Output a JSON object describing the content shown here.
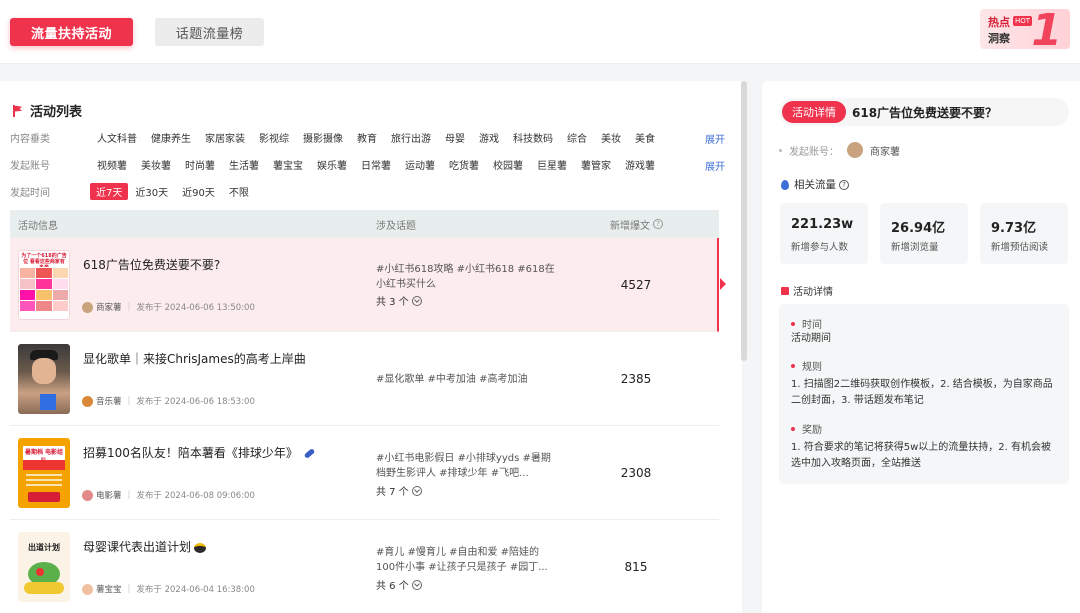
{
  "header": {
    "tab_active": "流量扶持活动",
    "tab_inactive": "话题流量榜",
    "hot_title": "热点",
    "hot_badge": "HOT",
    "hot_subtitle": "洞察",
    "hot_number": "1"
  },
  "list": {
    "title": "活动列表",
    "filters": [
      {
        "label": "内容垂类",
        "items": [
          "人文科普",
          "健康养生",
          "家居家装",
          "影视综",
          "摄影摄像",
          "教育",
          "旅行出游",
          "母婴",
          "游戏",
          "科技数码",
          "综合",
          "美妆",
          "美食"
        ],
        "expand": "展开"
      },
      {
        "label": "发起账号",
        "items": [
          "视频薯",
          "美妆薯",
          "时尚薯",
          "生活薯",
          "薯宝宝",
          "娱乐薯",
          "日常薯",
          "运动薯",
          "吃货薯",
          "校园薯",
          "巨星薯",
          "薯管家",
          "游戏薯"
        ],
        "expand": "展开"
      },
      {
        "label": "发起时间",
        "items": [
          "近7天",
          "近30天",
          "近90天",
          "不限"
        ],
        "selected": "近7天"
      }
    ],
    "columns": {
      "info": "活动信息",
      "topic": "涉及话题",
      "new": "新增爆文"
    },
    "rows": [
      {
        "title": "618广告位免费送要不要?",
        "author": "商家薯",
        "published": "发布于  2024-06-06 13:50:00",
        "topics": "#小红书618攻略 #小红书618 #618在小红书买什么",
        "count": "共 3 个",
        "num": "4527",
        "thumb_text": "为了一个618的广告位 看看这些商家有多卷"
      },
      {
        "title": "显化歌单｜来接ChrisJames的高考上岸曲",
        "author": "音乐薯",
        "published": "发布于  2024-06-06 18:53:00",
        "topics": "#显化歌单 #中考加油 #高考加油",
        "count": "",
        "num": "2385",
        "thumb_text": ""
      },
      {
        "title": "招募100名队友！陪本薯看《排球少年》",
        "author": "电影薯",
        "published": "发布于  2024-06-08 09:06:00",
        "topics": "#小红书电影假日 #小排球yyds #暑期档野生影评人 #排球少年 #飞吧...",
        "count": "共 7 个",
        "num": "2308",
        "thumb_text": "暑期档 电影组队"
      },
      {
        "title": "母婴课代表出道计划",
        "author": "薯宝宝",
        "published": "发布于  2024-06-04 16:38:00",
        "topics": "#育儿 #慢育儿 #自由和爱 #陪娃的100件小事 #让孩子只是孩子 #园丁...",
        "count": "共 6 个",
        "num": "815",
        "thumb_text": "出道计划"
      }
    ]
  },
  "detail": {
    "pill": "活动详情",
    "title": "618广告位免费送要不要？",
    "account_label": "发起账号：",
    "account_name": "商家薯",
    "flow_title": "相关流量",
    "stats": [
      {
        "value": "221.23w",
        "label": "新增参与人数"
      },
      {
        "value": "26.94亿",
        "label": "新增浏览量"
      },
      {
        "value": "9.73亿",
        "label": "新增预估阅读"
      }
    ],
    "activity_title": "活动详情",
    "sections": [
      {
        "title": "时间",
        "body": "活动期间"
      },
      {
        "title": "规则",
        "body": "1. 扫描图2二维码获取创作模板，2. 结合模板，为自家商品二创封面，3. 带话题发布笔记"
      },
      {
        "title": "奖励",
        "body": "1. 符合要求的笔记将获得5w以上的流量扶持，2. 有机会被选中加入攻略页面，全站推送"
      }
    ]
  },
  "colors": {
    "accent": "#f0334d",
    "link": "#3f6fd6"
  }
}
